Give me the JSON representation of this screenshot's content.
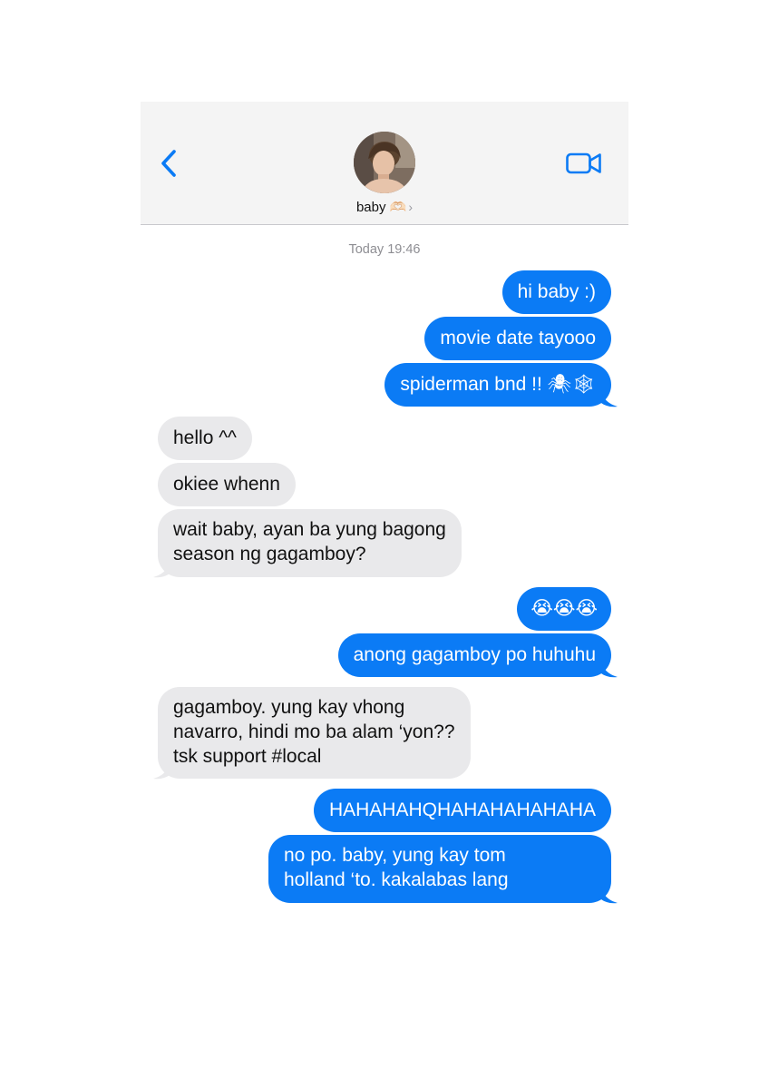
{
  "header": {
    "back_icon": "chevron-left-icon",
    "video_icon": "video-camera-icon",
    "contact_name": "baby 🫶🏻",
    "contact_chevron": "›"
  },
  "timestamp": "Today 19:46",
  "colors": {
    "sent": "#0b7bf5",
    "received": "#e9e9eb",
    "accent": "#0b7bf5",
    "header_bg": "#f4f4f4"
  },
  "messages": [
    {
      "from": "me",
      "text": "hi baby :)"
    },
    {
      "from": "me",
      "text": "movie date tayooo"
    },
    {
      "from": "me",
      "text": "spiderman bnd !! 🕷🕸"
    },
    {
      "from": "them",
      "text": "hello ^^"
    },
    {
      "from": "them",
      "text": "okiee whenn"
    },
    {
      "from": "them",
      "lines": [
        "wait baby, ayan ba yung bagong",
        "season ng gagamboy?"
      ]
    },
    {
      "from": "me",
      "text": "😭😭😭"
    },
    {
      "from": "me",
      "text": "anong gagamboy po huhuhu"
    },
    {
      "from": "them",
      "lines": [
        "gagamboy. yung kay vhong",
        "navarro, hindi mo ba alam ‘yon??",
        "tsk support #local"
      ]
    },
    {
      "from": "me",
      "text": "HAHAHAHQHAHAHAHAHAHA"
    },
    {
      "from": "me",
      "lines": [
        "no po. baby, yung kay tom",
        "holland ‘to. kakalabas lang"
      ]
    }
  ]
}
